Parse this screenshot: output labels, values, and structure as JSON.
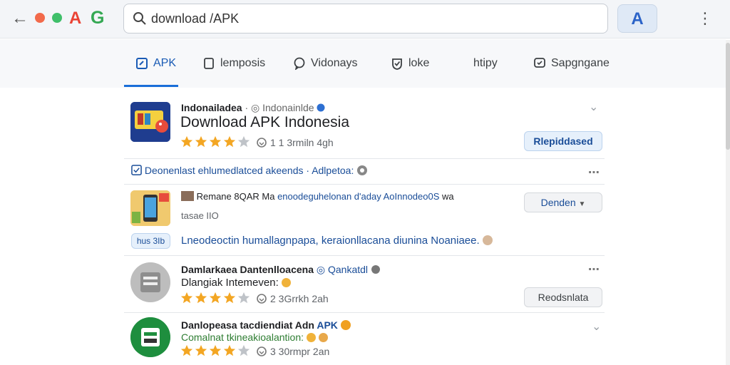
{
  "toolbar": {
    "back_icon": "back-arrow-icon",
    "logo_a": "A",
    "logo_g": "G",
    "search_value": "download /APK",
    "assistant_label": "A",
    "menu_icon": "vertical-dots-icon"
  },
  "tabs": [
    {
      "label": "APK",
      "icon": "edit-square-icon",
      "active": true
    },
    {
      "label": "lemposis",
      "icon": "document-icon",
      "active": false
    },
    {
      "label": "Vidonays",
      "icon": "chat-bubble-icon",
      "active": false
    },
    {
      "label": "loke",
      "icon": "shield-check-icon",
      "active": false
    },
    {
      "label": "htipy",
      "icon": "",
      "active": false
    },
    {
      "label": "Sapgngane",
      "icon": "message-icon",
      "active": false
    }
  ],
  "result1": {
    "source": "Indonailadea",
    "source_meta": "· ◎ Indonainlde",
    "title": "Download APK Indonesia",
    "rating_meta": "1 1 3rmiln 4gh",
    "button": "Rlepiddased",
    "stars_filled": 4
  },
  "related": {
    "label": "Deonenlast",
    "text": "ehlumedlatced akeends",
    "sep": "·",
    "suffix": "Adlpetoa:"
  },
  "result2": {
    "line1_prefix": "Remane 8QAR Ma",
    "line1_blue": "enoodeguhelonan d'aday AoInnodeo0S",
    "line1_suffix": "wa",
    "meta": "tasae IIO",
    "badge": "hus 3Ib",
    "button": "Denden",
    "snippet": "Lneodeoctin humallagnpapa, keraionllacana diunina Noaniaee."
  },
  "result3": {
    "source": "Damlarkaea Dantenlloacena",
    "source_meta": "◎ Qankatdl",
    "subtitle": "Dlangiak Intemeven:",
    "rating_meta": "2 3Grrkh 2ah",
    "button": "Reodsnlata",
    "stars_filled": 4
  },
  "result4": {
    "source": "Danlopeasa tacdiendiat Adn",
    "source_blue": "APK",
    "subtitle": "Comalnat tkineakioalantion:",
    "rating_meta": "3 30rmpr 2an",
    "stars_filled": 4
  },
  "colors": {
    "accent": "#1a6ed8",
    "star": "#f3a623",
    "star_empty": "#bfc3c8",
    "topbar": "#f3f5f8"
  }
}
